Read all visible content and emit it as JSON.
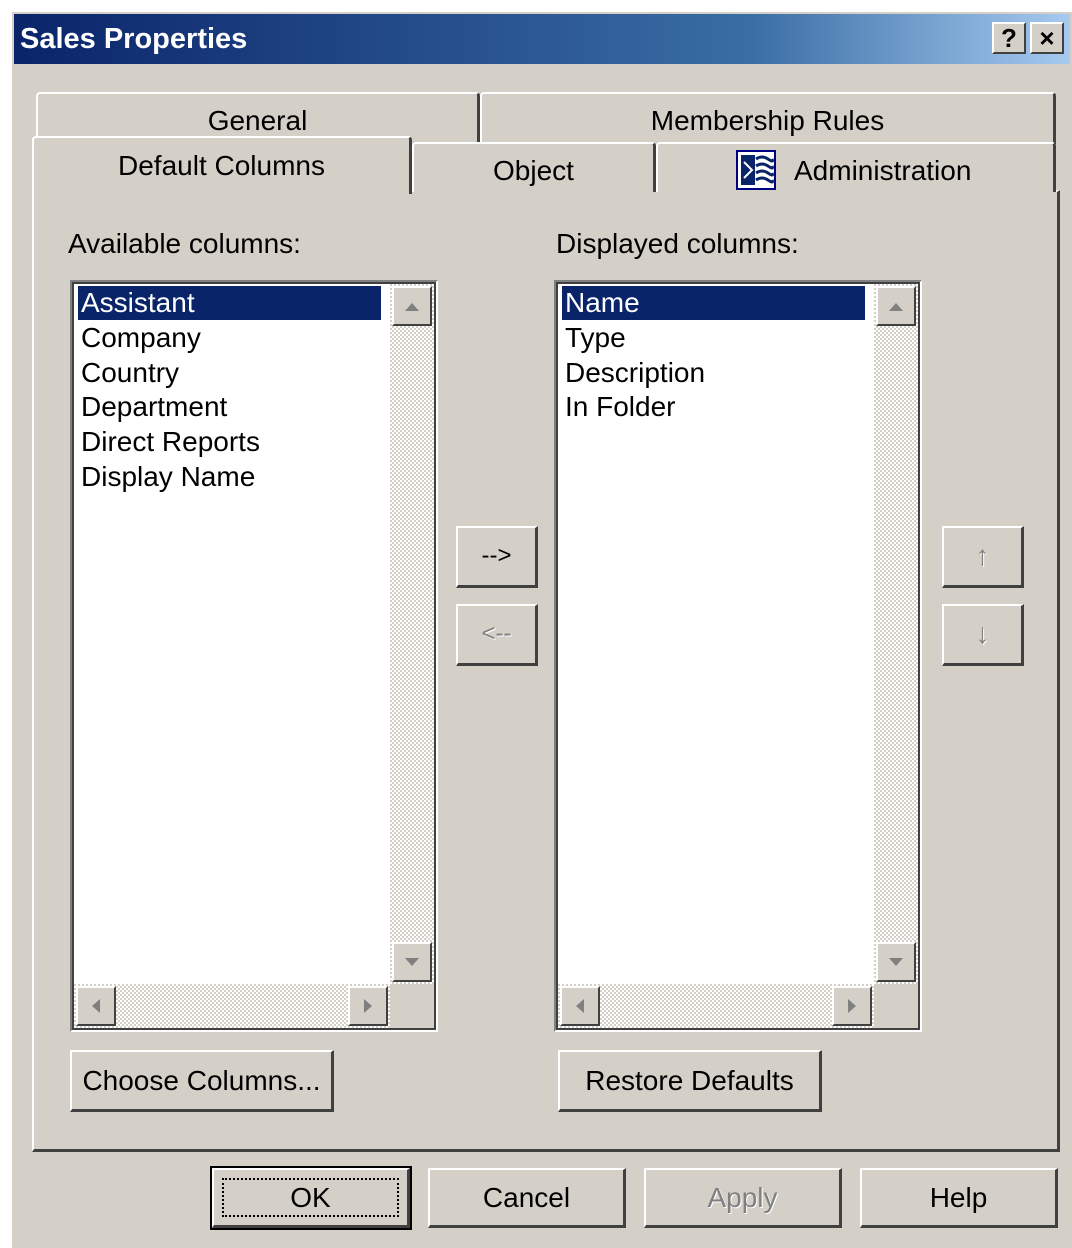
{
  "window": {
    "title": "Sales Properties"
  },
  "titlebar_buttons": {
    "help": "?",
    "close": "×"
  },
  "tabs": {
    "general": "General",
    "membership_rules": "Membership Rules",
    "default_columns": "Default Columns",
    "object": "Object",
    "administration": "Administration"
  },
  "available": {
    "label": "Available columns:",
    "items": [
      "Assistant",
      "Company",
      "Country",
      "Department",
      "Direct Reports",
      "Display Name"
    ],
    "selected": "Assistant"
  },
  "displayed": {
    "label": "Displayed columns:",
    "items": [
      "Name",
      "Type",
      "Description",
      "In Folder"
    ],
    "selected": "Name"
  },
  "move_buttons": {
    "add": "-->",
    "remove": "<--"
  },
  "order_buttons": {
    "up": "↑",
    "down": "↓"
  },
  "actions": {
    "choose_columns": "Choose Columns...",
    "restore_defaults": "Restore Defaults"
  },
  "footer": {
    "ok": "OK",
    "cancel": "Cancel",
    "apply": "Apply",
    "help": "Help"
  },
  "colors": {
    "titlebar": "#0a246a",
    "selection": "#0a246a",
    "face": "#d4d0c8"
  }
}
